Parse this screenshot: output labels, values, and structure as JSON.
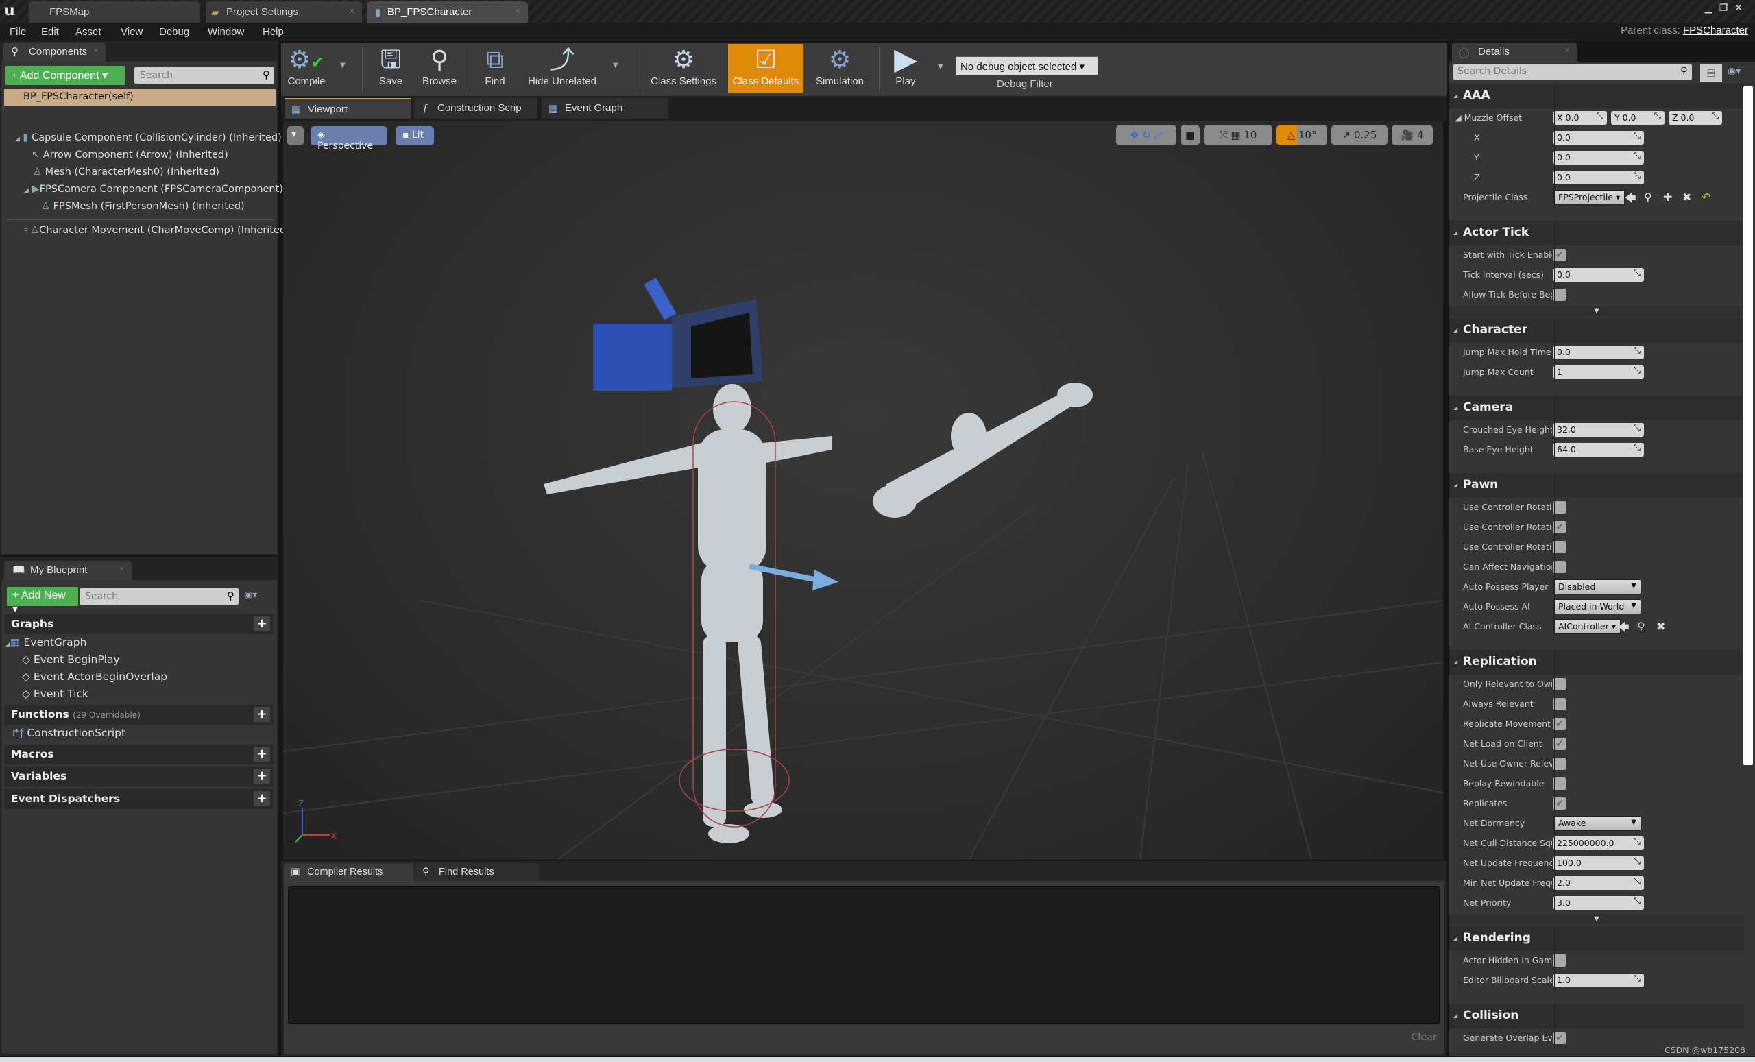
{
  "window_tabs": [
    {
      "label": "FPSMap"
    },
    {
      "label": "Project Settings"
    },
    {
      "label": "BP_FPSCharacter"
    }
  ],
  "menu": [
    "File",
    "Edit",
    "Asset",
    "View",
    "Debug",
    "Window",
    "Help"
  ],
  "parent_class": {
    "label": "Parent class:",
    "value": "FPSCharacter"
  },
  "components": {
    "tab": "Components",
    "add_button": "+ Add Component ▾",
    "search_placeholder": "Search",
    "self": "BP_FPSCharacter(self)",
    "tree": [
      "Capsule Component (CollisionCylinder) (Inherited)",
      "Arrow Component (Arrow) (Inherited)",
      "Mesh (CharacterMesh0) (Inherited)",
      "FPSCamera Component (FPSCameraComponent)",
      "FPSMesh (FirstPersonMesh) (Inherited)",
      "Character Movement (CharMoveComp) (Inherited)"
    ]
  },
  "my_blueprint": {
    "tab": "My Blueprint",
    "add_button": "+ Add New ▾",
    "search_placeholder": "Search",
    "graphs": "Graphs",
    "event_graph": "EventGraph",
    "events": [
      "Event BeginPlay",
      "Event ActorBeginOverlap",
      "Event Tick"
    ],
    "functions": "Functions",
    "functions_note": "(29 Overridable)",
    "construction": "ConstructionScript",
    "macros": "Macros",
    "variables": "Variables",
    "dispatchers": "Event Dispatchers"
  },
  "toolbar": {
    "compile": "Compile",
    "save": "Save",
    "browse": "Browse",
    "find": "Find",
    "hide_unrelated": "Hide Unrelated",
    "class_settings": "Class Settings",
    "class_defaults": "Class Defaults",
    "simulation": "Simulation",
    "play": "Play",
    "debug_object": "No debug object selected ▾",
    "debug_filter": "Debug Filter"
  },
  "doc_tabs": [
    "Viewport",
    "Construction Scrip",
    "Event Graph"
  ],
  "viewport": {
    "perspective": "Perspective",
    "lit": "Lit",
    "grid_snap": "10",
    "rot_snap": "10°",
    "scale_snap": "0.25",
    "camera_speed": "4",
    "accent": "#e08a0c"
  },
  "bottom": {
    "tabs": [
      "Compiler Results",
      "Find Results"
    ],
    "clear": "Clear"
  },
  "details": {
    "tab": "Details",
    "search_placeholder": "Search Details",
    "sections": [
      {
        "title": "AAA",
        "rows": [
          {
            "label": "Muzzle Offset",
            "type": "vec",
            "value": [
              "0.0",
              "0.0",
              "0.0"
            ]
          },
          {
            "label": "X",
            "type": "num",
            "value": "0.0",
            "indent": true
          },
          {
            "label": "Y",
            "type": "num",
            "value": "0.0",
            "indent": true
          },
          {
            "label": "Z",
            "type": "num",
            "value": "0.0",
            "indent": true
          },
          {
            "label": "Projectile Class",
            "type": "class",
            "value": "FPSProjectile"
          }
        ]
      },
      {
        "title": "Actor Tick",
        "more": true,
        "rows": [
          {
            "label": "Start with Tick Enabled",
            "type": "chk",
            "value": true
          },
          {
            "label": "Tick Interval (secs)",
            "type": "num",
            "value": "0.0"
          },
          {
            "label": "Allow Tick Before Begin Play",
            "type": "chk",
            "value": false
          }
        ]
      },
      {
        "title": "Character",
        "rows": [
          {
            "label": "Jump Max Hold Time",
            "type": "num",
            "value": "0.0"
          },
          {
            "label": "Jump Max Count",
            "type": "num",
            "value": "1"
          }
        ]
      },
      {
        "title": "Camera",
        "rows": [
          {
            "label": "Crouched Eye Height",
            "type": "num",
            "value": "32.0"
          },
          {
            "label": "Base Eye Height",
            "type": "num",
            "value": "64.0"
          }
        ]
      },
      {
        "title": "Pawn",
        "rows": [
          {
            "label": "Use Controller Rotation Pitch",
            "type": "chk",
            "value": false
          },
          {
            "label": "Use Controller Rotation Yaw",
            "type": "chk",
            "value": true
          },
          {
            "label": "Use Controller Rotation Roll",
            "type": "chk",
            "value": false
          },
          {
            "label": "Can Affect Navigation Generation",
            "type": "chk",
            "value": false
          },
          {
            "label": "Auto Possess Player",
            "type": "sel",
            "value": "Disabled"
          },
          {
            "label": "Auto Possess AI",
            "type": "sel",
            "value": "Placed in World"
          },
          {
            "label": "AI Controller Class",
            "type": "class2",
            "value": "AIController"
          }
        ]
      },
      {
        "title": "Replication",
        "more": true,
        "rows": [
          {
            "label": "Only Relevant to Owner",
            "type": "chk",
            "value": false
          },
          {
            "label": "Always Relevant",
            "type": "chk",
            "value": false
          },
          {
            "label": "Replicate Movement",
            "type": "chk",
            "value": true
          },
          {
            "label": "Net Load on Client",
            "type": "chk",
            "value": true
          },
          {
            "label": "Net Use Owner Relevancy",
            "type": "chk",
            "value": false
          },
          {
            "label": "Replay Rewindable",
            "type": "chk",
            "value": false
          },
          {
            "label": "Replicates",
            "type": "chk",
            "value": true
          },
          {
            "label": "Net Dormancy",
            "type": "sel",
            "value": "Awake"
          },
          {
            "label": "Net Cull Distance Squared",
            "type": "num",
            "value": "225000000.0"
          },
          {
            "label": "Net Update Frequency",
            "type": "num",
            "value": "100.0"
          },
          {
            "label": "Min Net Update Frequency",
            "type": "num",
            "value": "2.0"
          },
          {
            "label": "Net Priority",
            "type": "num",
            "value": "3.0"
          }
        ]
      },
      {
        "title": "Rendering",
        "rows": [
          {
            "label": "Actor Hidden In Game",
            "type": "chk",
            "value": false
          },
          {
            "label": "Editor Billboard Scale",
            "type": "num",
            "value": "1.0"
          }
        ]
      },
      {
        "title": "Collision",
        "rows": [
          {
            "label": "Generate Overlap Events",
            "type": "chk",
            "value": true
          }
        ]
      }
    ]
  },
  "watermark": "CSDN @wb175208"
}
